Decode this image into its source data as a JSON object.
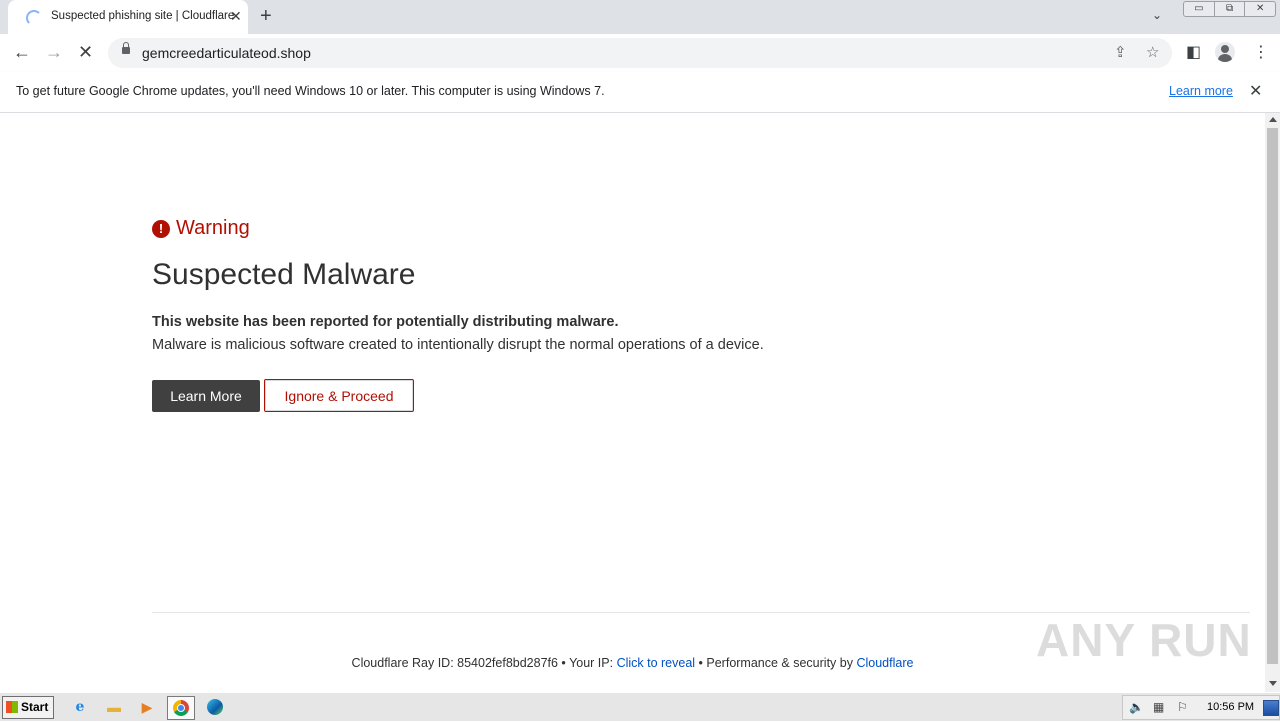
{
  "browser": {
    "tab": {
      "title": "Suspected phishing site | Cloudflare",
      "close": "✕"
    },
    "new_tab": "+",
    "tab_search": "⌄",
    "window_controls": {
      "minimize": "▭",
      "restore": "⧉",
      "close": "✕"
    },
    "nav": {
      "back": "←",
      "forward": "→",
      "stop": "✕"
    },
    "address_bar": {
      "url": "gemcreedarticulateod.shop"
    },
    "share_icon": "⇪",
    "bookmark_icon": "☆",
    "side_panel_icon": "◧",
    "menu_icon": "⋮"
  },
  "infobar": {
    "message": "To get future Google Chrome updates, you'll need Windows 10 or later. This computer is using Windows 7.",
    "link": "Learn more",
    "close": "✕"
  },
  "page": {
    "warning_icon": "!",
    "warning_label": "Warning",
    "title": "Suspected Malware",
    "lead": "This website has been reported for potentially distributing malware.",
    "description": "Malware is malicious software created to intentionally disrupt the normal operations of a device.",
    "buttons": {
      "learn_more": "Learn More",
      "ignore": "Ignore & Proceed"
    },
    "footer": {
      "ray_label": "Cloudflare Ray ID: ",
      "ray_id": "85402fef8bd287f6",
      "sep": " • ",
      "ip_label": "Your IP: ",
      "ip_link": "Click to reveal",
      "perf_label": "Performance & security by ",
      "perf_link": "Cloudflare"
    },
    "watermark": "ANY RUN"
  },
  "taskbar": {
    "start_label": "Start",
    "apps": [
      {
        "name": "internet-explorer",
        "glyph": "e"
      },
      {
        "name": "file-explorer",
        "glyph": "▬"
      },
      {
        "name": "media-player",
        "glyph": "▶"
      }
    ],
    "tray_icons": {
      "volume": "🔈",
      "network": "▦",
      "flag": "⚐"
    },
    "clock": "10:56 PM"
  },
  "colors": {
    "warning_red": "#b20f03",
    "link_blue": "#0051c3",
    "chrome_link": "#1a73e8",
    "dark_button": "#404040"
  }
}
